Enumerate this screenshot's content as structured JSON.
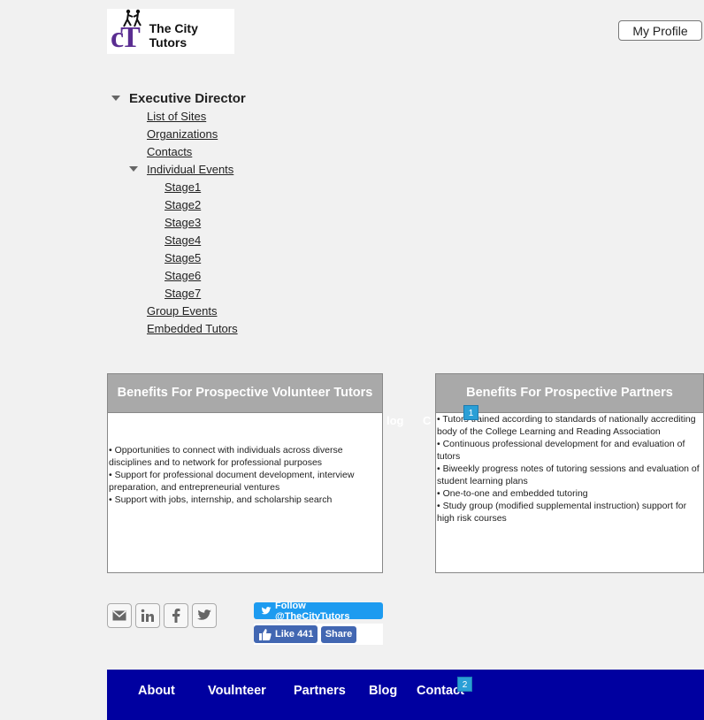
{
  "logo": {
    "initials": "cT",
    "name": "The City Tutors"
  },
  "header": {
    "profile_button": "My Profile"
  },
  "tree": {
    "root": "Executive Director",
    "items": [
      "List of Sites",
      "Organizations",
      "Contacts"
    ],
    "events_group": "Individual Events",
    "stages": [
      "Stage1",
      "Stage2",
      "Stage3",
      "Stage4",
      "Stage5",
      "Stage6",
      "Stage7"
    ],
    "after": [
      "Group Events",
      "Embedded Tutors"
    ]
  },
  "volunteer_box": {
    "title": "Benefits For Prospective Volunteer Tutors",
    "points": [
      "• Opportunities to connect with individuals across diverse disciplines and to network for professional purposes",
      "• Support for professional document development, interview preparation, and entrepreneurial ventures",
      "• Support with jobs, internship, and scholarship search"
    ]
  },
  "partners_box": {
    "title": "Benefits For Prospective Partners",
    "points": [
      "• Tutors trained according to standards of nationally accrediting body of the College Learning and Reading Association",
      "• Continuous professional development for and evaluation of tutors",
      "• Biweekly progress notes of tutoring sessions and evaluation of student learning plans",
      "• One-to-one and embedded tutoring",
      "• Study group (modified supplemental instruction) support for high risk courses"
    ]
  },
  "stray_text": {
    "blog": "log",
    "contact": "C"
  },
  "badges": {
    "first": "1",
    "second": "2"
  },
  "social": {
    "icons": [
      "email-icon",
      "linkedin-icon",
      "facebook-icon",
      "twitter-icon"
    ],
    "twitter_follow": "Follow @TheCityTutors",
    "fb_like": "Like 441",
    "fb_share": "Share"
  },
  "footer": {
    "nav": [
      "About",
      "Voulnteer",
      "Partners",
      "Blog",
      "Contact"
    ]
  },
  "colors": {
    "footer_bg": "#0000a0",
    "header_gray": "#a9a9a9",
    "accent_purple": "#5a2d91",
    "badge_blue": "#2a9fd6"
  }
}
